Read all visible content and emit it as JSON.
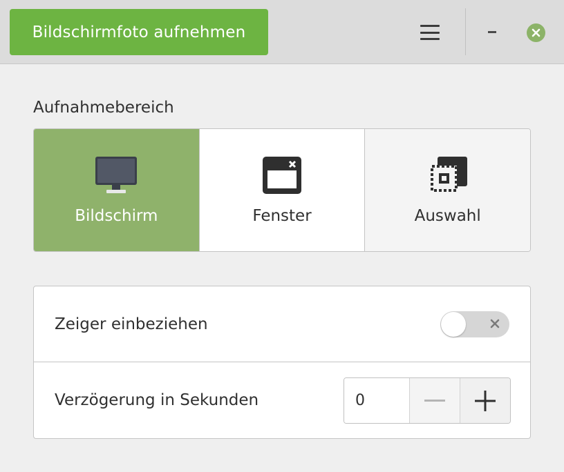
{
  "header": {
    "capture_label": "Bildschirmfoto aufnehmen",
    "menu_icon": "hamburger-menu-icon",
    "minimize_icon": "minimize-icon",
    "close_icon": "close-icon"
  },
  "area": {
    "heading": "Aufnahmebereich",
    "modes": [
      {
        "label": "Bildschirm",
        "icon": "monitor-icon",
        "selected": true
      },
      {
        "label": "Fenster",
        "icon": "window-icon",
        "selected": false
      },
      {
        "label": "Auswahl",
        "icon": "selection-icon",
        "selected": false
      }
    ]
  },
  "options": {
    "include_pointer": {
      "label": "Zeiger einbeziehen",
      "enabled": false
    },
    "delay": {
      "label": "Verzögerung in Sekunden",
      "value": "0"
    }
  },
  "colors": {
    "accent": "#6db442",
    "selected_mode": "#8fb26b",
    "close_button": "#8cb368",
    "header_bg": "#dcdcdc",
    "window_bg": "#efefef"
  }
}
